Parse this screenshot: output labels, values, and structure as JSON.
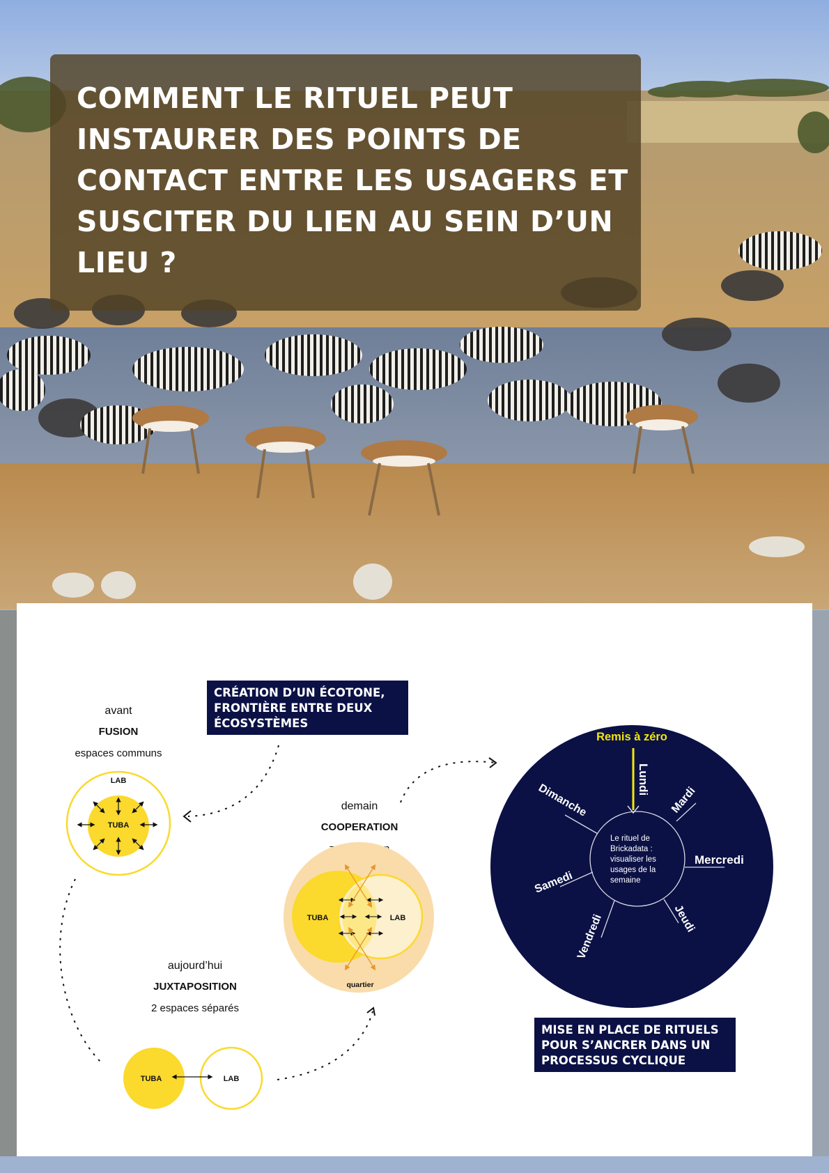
{
  "header": {
    "question": "COMMENT LE RITUEL PEUT INSTAURER DES POINTS DE CONTACT ENTRE LES USAGERS ET SUSCITER DU LIEN AU SEIN D’UN LIEU ?"
  },
  "callouts": {
    "ecotone": "CRÉATION D’UN ÉCOTONE, FRONTIÈRE ENTRE DEUX ÉCOSYSTÈMES",
    "rituels": "MISE EN PLACE DE RITUELS POUR S’ANCRER DANS UN PROCESSUS CYCLIQUE"
  },
  "stages": {
    "avant": {
      "when": "avant",
      "name": "FUSION",
      "desc": "espaces communs",
      "inner": "TUBA",
      "outer": "LAB"
    },
    "aujourdhui": {
      "when": "aujourd’hui",
      "name": "JUXTAPOSITION",
      "desc": "2 espaces séparés",
      "left": "TUBA",
      "right": "LAB"
    },
    "demain": {
      "when": "demain",
      "name": "COOPERATION",
      "desc": "zone tampon",
      "left": "TUBA",
      "right": "LAB",
      "outer": "quartier"
    }
  },
  "cycle": {
    "reset": "Remis à zéro",
    "days": [
      "Lundi",
      "Mardi",
      "Mercredi",
      "Jeudi",
      "Vendredi",
      "Samedi",
      "Dimanche"
    ],
    "center_text": [
      "Le rituel de",
      "Brickadata :",
      "visualiser les",
      "usages de la",
      "semaine"
    ]
  },
  "colors": {
    "navy": "#0b1145",
    "yellow": "#fbd92d",
    "reset_yellow": "#f2e60d",
    "buffer": "#f9dcaa",
    "arrow_orange": "#e8952a"
  }
}
